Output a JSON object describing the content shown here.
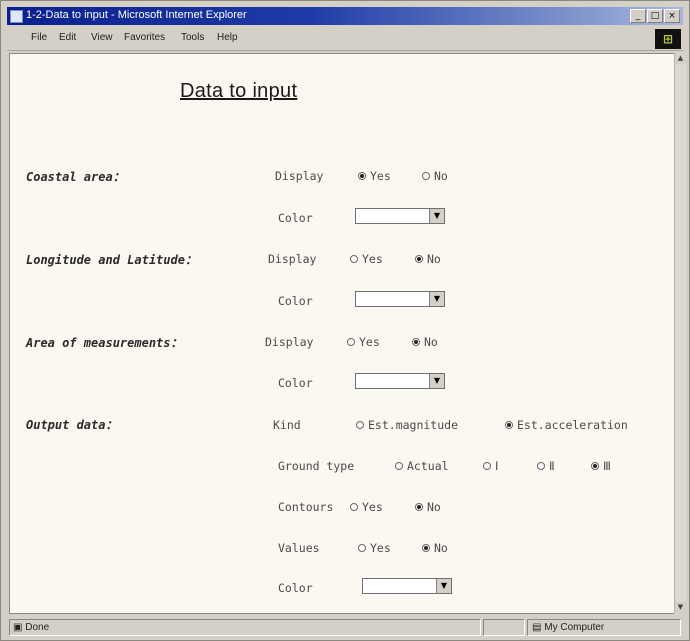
{
  "window": {
    "title": "1-2-Data to input - Microsoft Internet Explorer"
  },
  "menu": [
    "File",
    "Edit",
    "View",
    "Favorites",
    "Tools",
    "Help"
  ],
  "page": {
    "title": "Data to input",
    "coastal": {
      "label": "Coastal area：",
      "display_label": "Display",
      "yes": "Yes",
      "no": "No",
      "selected": "yes",
      "color_label": "Color",
      "color_value": ""
    },
    "lonlat": {
      "label": "Longitude and Latitude：",
      "display_label": "Display",
      "yes": "Yes",
      "no": "No",
      "selected": "no",
      "color_label": "Color",
      "color_value": ""
    },
    "area": {
      "label": "Area of measurements：",
      "display_label": "Display",
      "yes": "Yes",
      "no": "No",
      "selected": "no",
      "color_label": "Color",
      "color_value": ""
    },
    "output": {
      "label": "Output data：",
      "kind_label": "Kind",
      "kind_options": [
        "Est.magnitude",
        "Est.acceleration"
      ],
      "kind_selected": "Est.acceleration",
      "ground_label": "Ground type",
      "ground_options": [
        "Actual",
        "Ⅰ",
        "Ⅱ",
        "Ⅲ"
      ],
      "ground_selected": "Ⅲ",
      "contours_label": "Contours",
      "contours_yes": "Yes",
      "contours_no": "No",
      "contours_selected": "no",
      "values_label": "Values",
      "values_yes": "Yes",
      "values_no": "No",
      "values_selected": "no",
      "color_label": "Color",
      "color_value": ""
    }
  },
  "status": {
    "left": "Done",
    "zone": "My Computer"
  }
}
